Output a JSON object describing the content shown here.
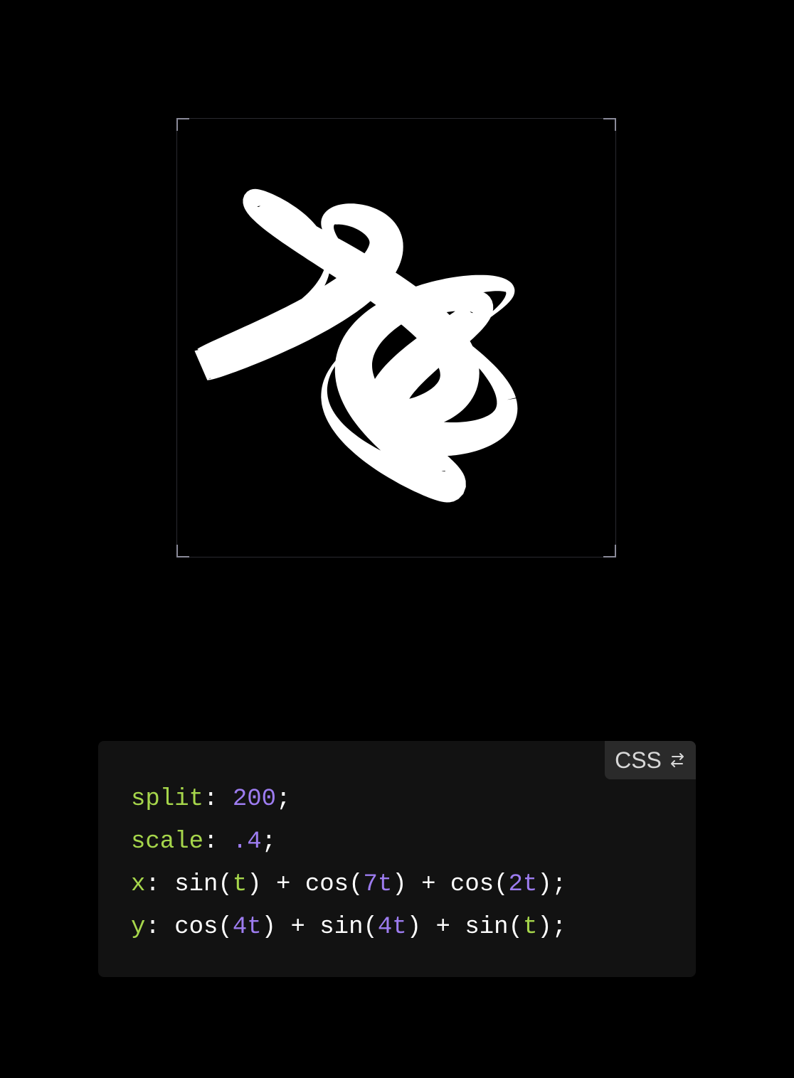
{
  "preview": {
    "curve": {
      "split": 200,
      "scale": 0.4,
      "x_expr": "sin(t) + cos(7t) + cos(2t)",
      "y_expr": "cos(4t) + sin(4t) + sin(t)"
    },
    "colors": {
      "background": "#000000",
      "stroke": "#ffffff",
      "frame": "#2a2a30",
      "corner": "#8a8a99"
    }
  },
  "code_panel": {
    "lang_label": "CSS",
    "lang_icon": "swap-arrows-icon",
    "colors": {
      "background": "#121212",
      "property": "#a6d64b",
      "number": "#9d7cf0",
      "variable": "#a6d64b",
      "text": "#ffffff"
    },
    "lines": [
      {
        "prop": "split",
        "tokens": [
          {
            "t": "n",
            "v": "200"
          },
          {
            "t": "p",
            "v": ";"
          }
        ]
      },
      {
        "prop": "scale",
        "tokens": [
          {
            "t": "n",
            "v": ".4"
          },
          {
            "t": "p",
            "v": ";"
          }
        ]
      },
      {
        "prop": "x",
        "tokens": [
          {
            "t": "p",
            "v": "sin("
          },
          {
            "t": "v",
            "v": "t"
          },
          {
            "t": "p",
            "v": ") + cos("
          },
          {
            "t": "n",
            "v": "7t"
          },
          {
            "t": "p",
            "v": ") + cos("
          },
          {
            "t": "n",
            "v": "2t"
          },
          {
            "t": "p",
            "v": ");"
          }
        ]
      },
      {
        "prop": "y",
        "tokens": [
          {
            "t": "p",
            "v": "cos("
          },
          {
            "t": "n",
            "v": "4t"
          },
          {
            "t": "p",
            "v": ") + sin("
          },
          {
            "t": "n",
            "v": "4t"
          },
          {
            "t": "p",
            "v": ") + sin("
          },
          {
            "t": "v",
            "v": "t"
          },
          {
            "t": "p",
            "v": ");"
          }
        ]
      }
    ]
  }
}
